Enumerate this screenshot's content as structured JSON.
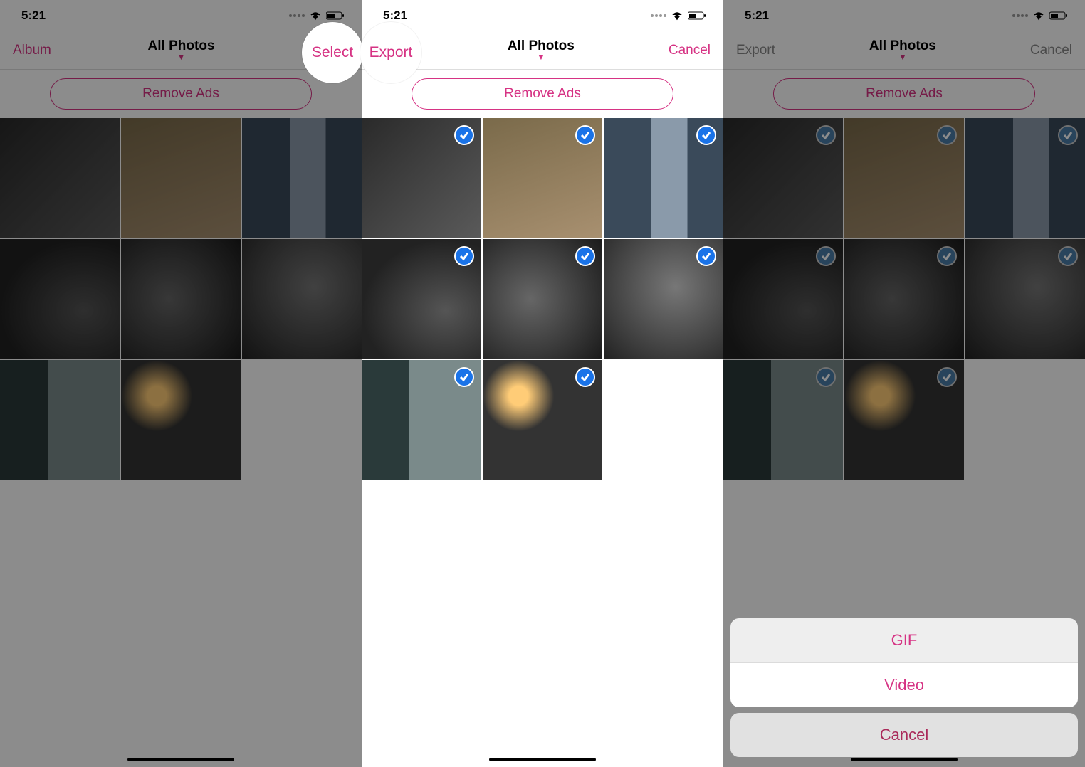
{
  "screens": {
    "s1": {
      "time": "5:21",
      "headerLeft": "Album",
      "title": "All Photos",
      "headerRight": "Select",
      "removeAds": "Remove Ads",
      "callout": "Select"
    },
    "s2": {
      "time": "5:21",
      "headerLeft": "Export",
      "title": "All Photos",
      "headerRight": "Cancel",
      "removeAds": "Remove Ads",
      "callout": "Export"
    },
    "s3": {
      "time": "5:21",
      "headerLeft": "Export",
      "title": "All Photos",
      "headerRight": "Cancel",
      "removeAds": "Remove Ads",
      "sheet": {
        "gif": "GIF",
        "video": "Video",
        "cancel": "Cancel"
      }
    }
  },
  "accentColor": "#d63384",
  "checkColor": "#1a73e8"
}
